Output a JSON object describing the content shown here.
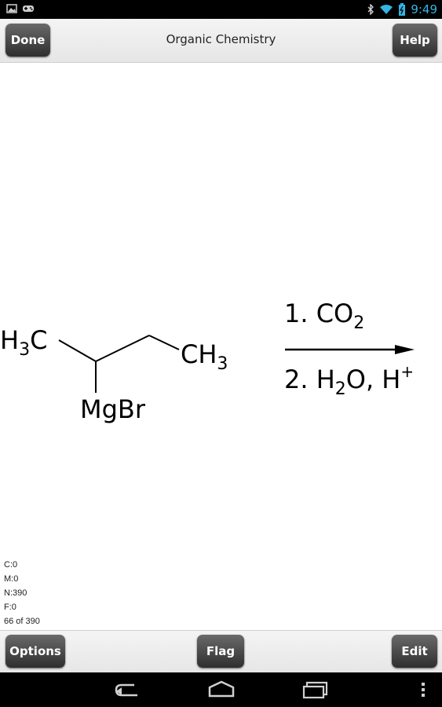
{
  "status_bar": {
    "time": "9:49",
    "icons": [
      "picture-icon",
      "game-controller-icon",
      "bluetooth-icon",
      "wifi-icon",
      "battery-icon"
    ]
  },
  "top_bar": {
    "title": "Organic Chemistry",
    "done_label": "Done",
    "help_label": "Help"
  },
  "card": {
    "reactant": {
      "left_group_main": "H",
      "left_group_sub": "3",
      "left_group_end": "C",
      "right_group_main": "CH",
      "right_group_sub": "3",
      "substituent": "MgBr"
    },
    "reagents": {
      "step1_prefix": "1. CO",
      "step1_sub": "2",
      "step2_prefix": "2. H",
      "step2_sub": "2",
      "step2_mid": "O, H",
      "step2_sup": "+"
    }
  },
  "stats": {
    "c": "C:0",
    "m": "M:0",
    "n": "N:390",
    "f": "F:0",
    "position": "66 of 390"
  },
  "bottom_bar": {
    "options_label": "Options",
    "flag_label": "Flag",
    "edit_label": "Edit"
  },
  "nav_bar": {
    "icons": [
      "back-icon",
      "home-icon",
      "recent-apps-icon",
      "menu-icon"
    ]
  },
  "colors": {
    "accent": "#33b5e5",
    "button_dark": "#3a3a3a",
    "bar_light": "#eeeeee"
  }
}
